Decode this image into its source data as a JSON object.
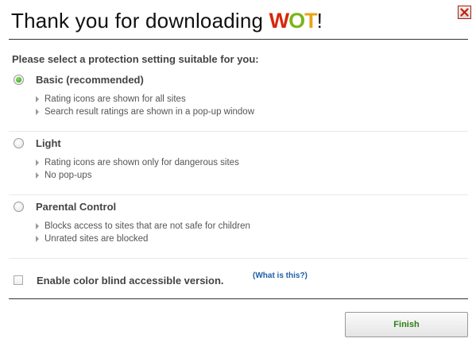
{
  "dialog": {
    "title_prefix": "Thank you for downloading ",
    "logo": {
      "w": "W",
      "o": "O",
      "t": "T"
    },
    "title_suffix": "!",
    "prompt": "Please select a protection setting suitable for you:"
  },
  "options": [
    {
      "label": "Basic (recommended)",
      "selected": true,
      "bullets": [
        "Rating icons are shown for all sites",
        "Search result ratings are shown in a pop-up window"
      ]
    },
    {
      "label": "Light",
      "selected": false,
      "bullets": [
        "Rating icons are shown only for dangerous sites",
        "No pop-ups"
      ]
    },
    {
      "label": "Parental Control",
      "selected": false,
      "bullets": [
        "Blocks access to sites that are not safe for children",
        "Unrated sites are blocked"
      ]
    }
  ],
  "colorblind": {
    "label": "Enable color blind accessible version.",
    "link": "(What is this?)",
    "checked": false
  },
  "buttons": {
    "finish": "Finish"
  },
  "colors": {
    "logo_w": "#d8260c",
    "logo_o": "#7cb518",
    "logo_t": "#e8a317",
    "radio_selected": "#1c9a0c",
    "link": "#1d5fa6",
    "finish_text": "#2e7d14",
    "close_border": "#b01a08"
  }
}
